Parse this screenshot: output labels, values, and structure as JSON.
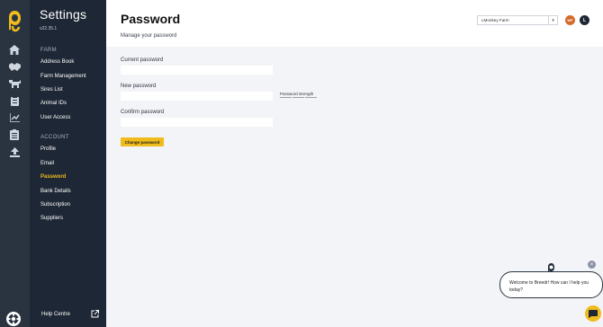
{
  "app": {
    "title": "Settings",
    "version": "v22.35.1",
    "colors": {
      "accent": "#f0bb1c",
      "sidebar": "#1e2735",
      "rail": "#2a3441"
    }
  },
  "rail": {
    "icons": [
      "home-icon",
      "handshake-icon",
      "cow-icon",
      "clipboard-icon",
      "chart-icon",
      "checklist-icon",
      "upload-icon"
    ],
    "bottom_icon": "gear-icon"
  },
  "sidebar": {
    "farm_section": "FARM",
    "farm_items": [
      {
        "label": "Address Book"
      },
      {
        "label": "Farm Management"
      },
      {
        "label": "Sires List"
      },
      {
        "label": "Animal IDs"
      },
      {
        "label": "User Access"
      }
    ],
    "account_section": "ACCOUNT",
    "account_items": [
      {
        "label": "Profile"
      },
      {
        "label": "Email"
      },
      {
        "label": "Password",
        "active": true
      },
      {
        "label": "Bank Details"
      },
      {
        "label": "Subscription"
      },
      {
        "label": "Suppliers"
      }
    ],
    "help": "Help Centre"
  },
  "header": {
    "title": "Password",
    "subtitle": "Manage your password",
    "farm_select": "LMonkey Farm",
    "badge_wf": "WF",
    "user_initial": "L"
  },
  "form": {
    "current_label": "Current password",
    "current_value": "",
    "new_label": "New password",
    "new_value": "",
    "strength_label": "Password strength",
    "confirm_label": "Confirm password",
    "confirm_value": "",
    "submit": "Change password"
  },
  "chat": {
    "message": "Welcome to Breedr! How can I help you today?",
    "close": "×"
  }
}
